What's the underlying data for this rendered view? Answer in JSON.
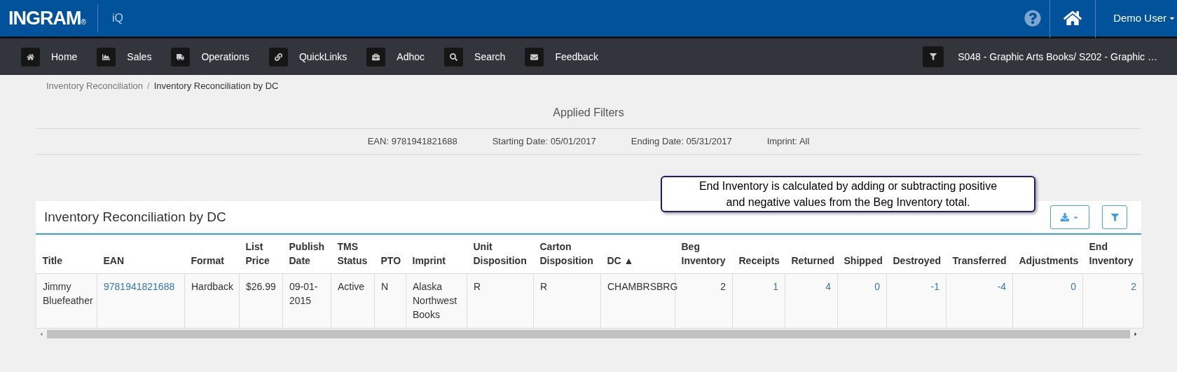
{
  "header": {
    "brand": "INGRAM",
    "brand_mark": "®",
    "app": "iQ",
    "user": "Demo User"
  },
  "nav": {
    "items": [
      {
        "label": "Home"
      },
      {
        "label": "Sales"
      },
      {
        "label": "Operations"
      },
      {
        "label": "QuickLinks"
      },
      {
        "label": "Adhoc"
      },
      {
        "label": "Search"
      },
      {
        "label": "Feedback"
      }
    ],
    "context": "S048 - Graphic Arts Books/ S202 - Graphic …"
  },
  "breadcrumb": {
    "separator": "/",
    "items": [
      "Inventory Reconciliation",
      "Inventory Reconciliation by DC"
    ]
  },
  "applied_filters": {
    "title": "Applied Filters",
    "filters": [
      "EAN: 9781941821688",
      "Starting Date: 05/01/2017",
      "Ending Date: 05/31/2017",
      "Imprint: All"
    ]
  },
  "callout": "End Inventory is calculated by adding or subtracting positive and negative values from the Beg Inventory total.",
  "panel": {
    "title": "Inventory Reconciliation by DC",
    "columns": [
      {
        "label": "Title"
      },
      {
        "label": "EAN"
      },
      {
        "label": "Format"
      },
      {
        "label": "List Price"
      },
      {
        "label": "Publish Date"
      },
      {
        "label": "TMS Status"
      },
      {
        "label": "PTO"
      },
      {
        "label": "Imprint"
      },
      {
        "label": "Unit Disposition"
      },
      {
        "label": "Carton Disposition"
      },
      {
        "label": "DC",
        "sort_indicator": "▲"
      },
      {
        "label": "Beg Inventory",
        "numeric": true
      },
      {
        "label": "Receipts",
        "numeric": true
      },
      {
        "label": "Returned",
        "numeric": true
      },
      {
        "label": "Shipped",
        "numeric": true
      },
      {
        "label": "Destroyed",
        "numeric": true
      },
      {
        "label": "Transferred",
        "numeric": true
      },
      {
        "label": "Adjustments",
        "numeric": true
      },
      {
        "label": "End Inventory",
        "numeric": true
      }
    ],
    "rows": [
      [
        {
          "text": "Jimmy Bluefeather",
          "link": false
        },
        {
          "text": "9781941821688",
          "link": true
        },
        {
          "text": "Hardback",
          "link": false
        },
        {
          "text": "$26.99",
          "link": false
        },
        {
          "text": "09-01-2015",
          "link": false
        },
        {
          "text": "Active",
          "link": false
        },
        {
          "text": "N",
          "link": false
        },
        {
          "text": "Alaska Northwest Books",
          "link": false
        },
        {
          "text": "R",
          "link": false
        },
        {
          "text": "R",
          "link": false
        },
        {
          "text": "CHAMBRSBRG",
          "link": false
        },
        {
          "text": "2",
          "link": false
        },
        {
          "text": "1",
          "link": true
        },
        {
          "text": "4",
          "link": true
        },
        {
          "text": "0",
          "link": true
        },
        {
          "text": "-1",
          "link": true
        },
        {
          "text": "-4",
          "link": true
        },
        {
          "text": "0",
          "link": true
        },
        {
          "text": "2",
          "link": true
        }
      ]
    ]
  }
}
